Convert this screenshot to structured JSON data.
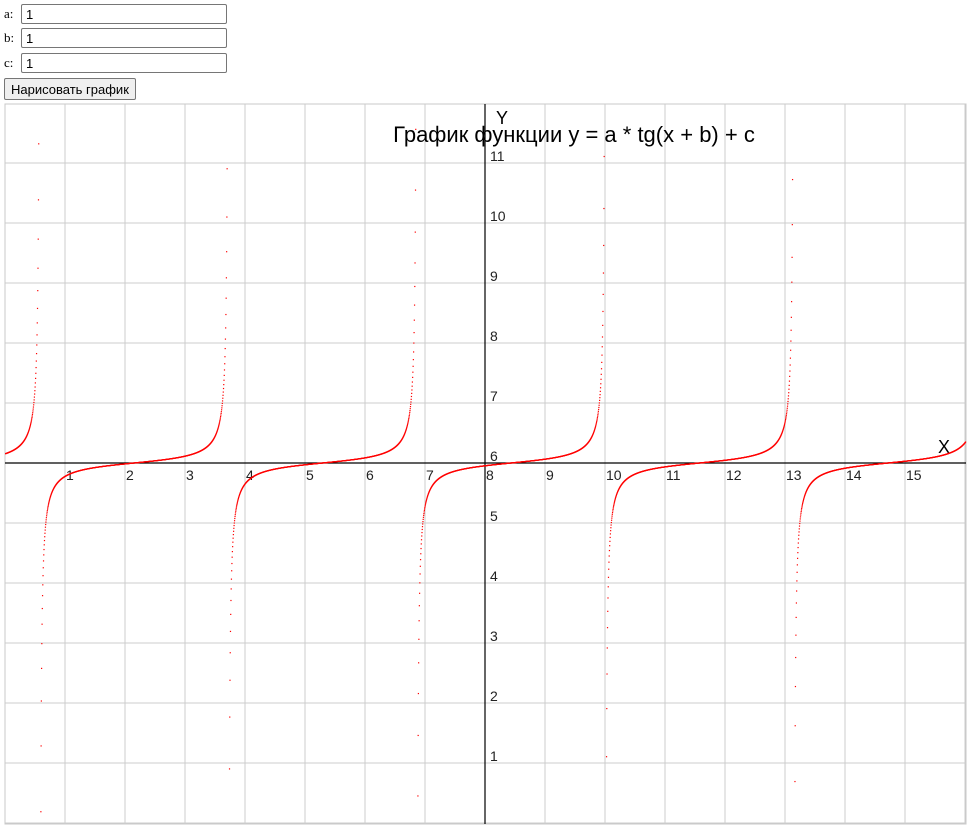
{
  "form": {
    "a": {
      "label": "a:",
      "value": "1"
    },
    "b": {
      "label": "b:",
      "value": "1"
    },
    "c": {
      "label": "c:",
      "value": "1"
    },
    "draw_button": "Нарисовать график"
  },
  "chart_data": {
    "type": "line",
    "title": "График функции y = a * tg(x + b) + c",
    "function": "y = a * tg(x + b) + c",
    "params": {
      "a": 1,
      "b": 1,
      "c": 1
    },
    "xlabel": "X",
    "ylabel": "Y",
    "xlim": [
      0,
      16
    ],
    "ylim": [
      0,
      12
    ],
    "x_ticks": [
      "1",
      "2",
      "3",
      "4",
      "5",
      "6",
      "7",
      "8",
      "9",
      "10",
      "11",
      "12",
      "13",
      "14",
      "15"
    ],
    "y_ticks_upper": [
      "6",
      "7",
      "8",
      "9",
      "10",
      "11"
    ],
    "y_ticks_lower": [
      "5",
      "4",
      "3",
      "2",
      "1"
    ],
    "grid": true,
    "curve_color": "#ff0000",
    "axis_color": "#000000",
    "grid_color": "#cccccc"
  }
}
